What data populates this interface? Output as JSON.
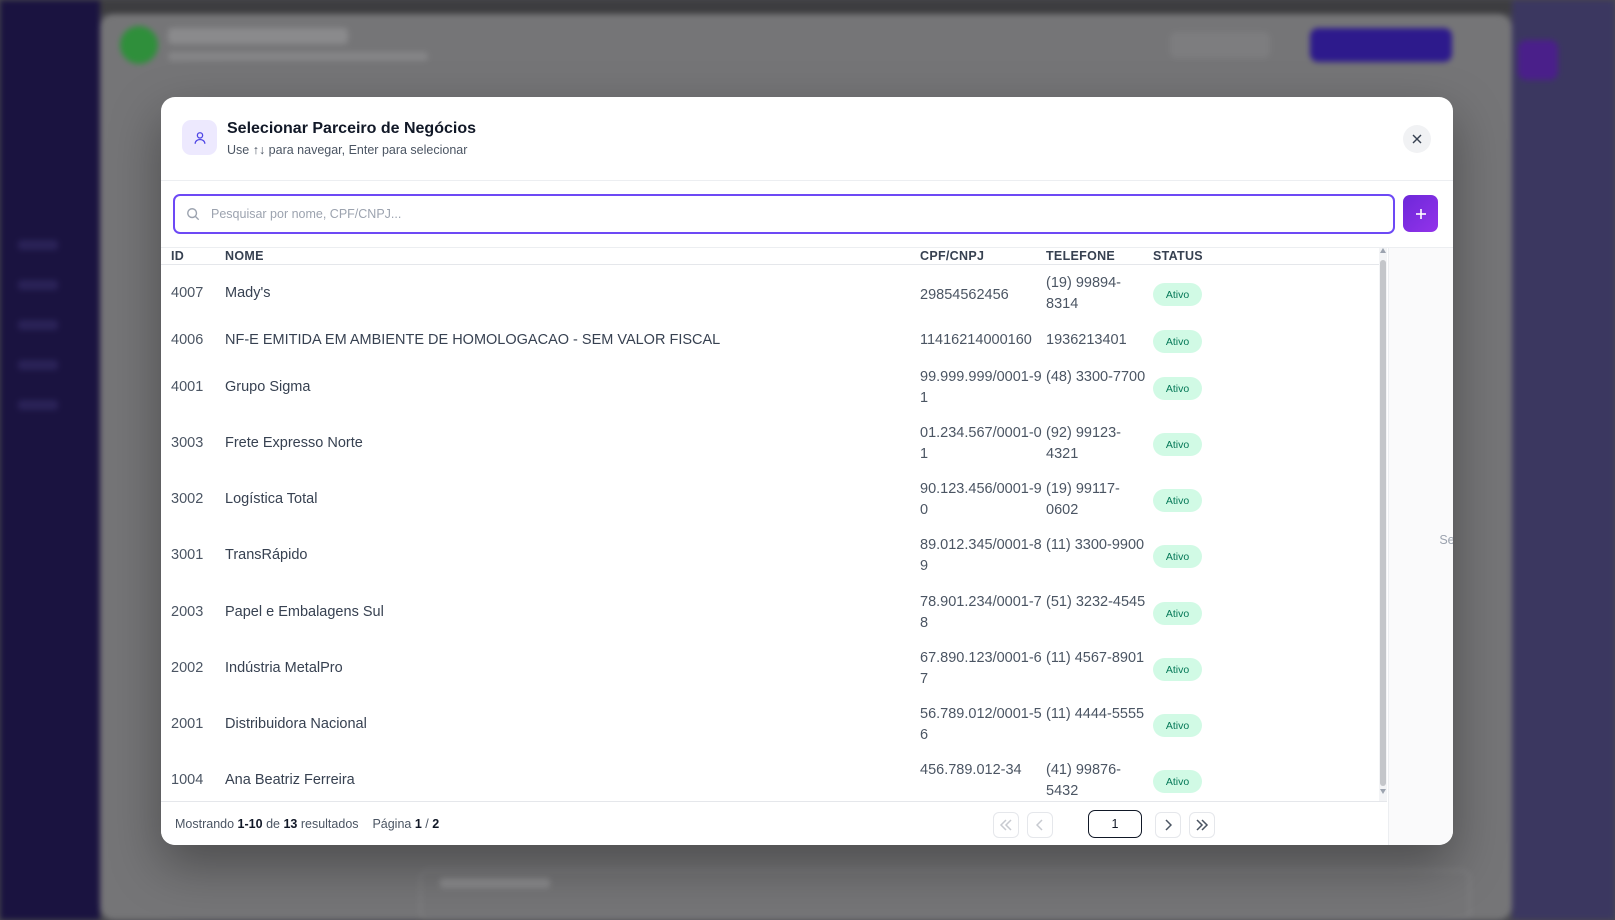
{
  "modal": {
    "title": "Selecionar Parceiro de Negócios",
    "subtitle": "Use ↑↓ para navegar, Enter para selecionar",
    "icon": "user-icon",
    "close_icon": "close-icon"
  },
  "search": {
    "placeholder": "Pesquisar por nome, CPF/CNPJ...",
    "value": "",
    "add_icon": "plus-icon"
  },
  "table": {
    "headers": {
      "id": "ID",
      "nome": "NOME",
      "doc": "CPF/CNPJ",
      "tel": "TELEFONE",
      "status": "STATUS"
    },
    "rows": [
      {
        "id": "4007",
        "nome": "Mady's",
        "doc": "29854562456",
        "tel": "(19) 99894-8314",
        "status": "Ativo"
      },
      {
        "id": "4006",
        "nome": "NF-E EMITIDA EM AMBIENTE DE HOMOLOGACAO - SEM VALOR FISCAL",
        "doc": "11416214000160",
        "tel": "1936213401",
        "status": "Ativo"
      },
      {
        "id": "4001",
        "nome": "Grupo Sigma",
        "doc": "99.999.999/0001-91",
        "tel": "(48) 3300-7700",
        "status": "Ativo"
      },
      {
        "id": "3003",
        "nome": "Frete Expresso Norte",
        "doc": "01.234.567/0001-01",
        "tel": "(92) 99123-4321",
        "status": "Ativo"
      },
      {
        "id": "3002",
        "nome": "Logística Total",
        "doc": "90.123.456/0001-90",
        "tel": "(19) 99117-0602",
        "status": "Ativo"
      },
      {
        "id": "3001",
        "nome": "TransRápido",
        "doc": "89.012.345/0001-89",
        "tel": "(11) 3300-9900",
        "status": "Ativo"
      },
      {
        "id": "2003",
        "nome": "Papel e Embalagens Sul",
        "doc": "78.901.234/0001-78",
        "tel": "(51) 3232-4545",
        "status": "Ativo"
      },
      {
        "id": "2002",
        "nome": "Indústria MetalPro",
        "doc": "67.890.123/0001-67",
        "tel": "(11) 4567-8901",
        "status": "Ativo"
      },
      {
        "id": "2001",
        "nome": "Distribuidora Nacional",
        "doc": "56.789.012/0001-56",
        "tel": "(11) 4444-5555",
        "status": "Ativo"
      },
      {
        "id": "1004",
        "nome": "Ana Beatriz Ferreira",
        "doc": "456.789.012-34",
        "tel": "(41) 99876-5432",
        "status": "Ativo"
      }
    ]
  },
  "side_panel": {
    "empty_text": "Selecione um parceiro"
  },
  "footer": {
    "showing_label": "Mostrando",
    "range": "1-10",
    "of_label": "de",
    "total": "13",
    "results_label": "resultados",
    "page_label": "Página",
    "current_page": "1",
    "separator": "/",
    "total_pages": "2",
    "page_input_value": "1"
  },
  "colors": {
    "accent": "#6d49f5",
    "status_bg": "#d1fae5",
    "status_text": "#047857"
  }
}
